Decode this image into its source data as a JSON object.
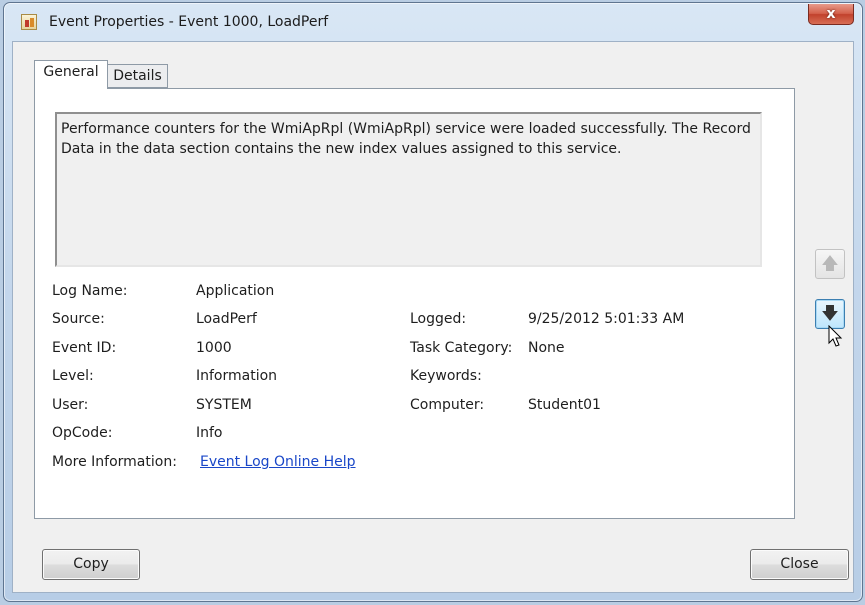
{
  "window": {
    "title": "Event Properties - Event 1000, LoadPerf",
    "close_glyph": "x"
  },
  "tabs": [
    {
      "label": "General",
      "selected": true
    },
    {
      "label": "Details",
      "selected": false
    }
  ],
  "description": "Performance counters for the WmiApRpl (WmiApRpl) service were loaded successfully. The Record Data in the data section contains the new index values assigned to this service.",
  "fields": {
    "log_name": {
      "label": "Log Name:",
      "value": "Application"
    },
    "source": {
      "label": "Source:",
      "value": "LoadPerf"
    },
    "event_id": {
      "label": "Event ID:",
      "value": "1000"
    },
    "level": {
      "label": "Level:",
      "value": "Information"
    },
    "user": {
      "label": "User:",
      "value": "SYSTEM"
    },
    "opcode": {
      "label": "OpCode:",
      "value": "Info"
    },
    "more_info": {
      "label": "More Information:",
      "link": "Event Log Online Help"
    },
    "logged": {
      "label": "Logged:",
      "value": "9/25/2012 5:01:33 AM"
    },
    "task_category": {
      "label": "Task Category:",
      "value": "None"
    },
    "keywords": {
      "label": "Keywords:",
      "value": ""
    },
    "computer": {
      "label": "Computer:",
      "value": "Student01"
    }
  },
  "nav": {
    "up_icon": "arrow-up-icon",
    "down_icon": "arrow-down-icon",
    "up_enabled": false,
    "down_enabled": true
  },
  "buttons": {
    "copy": "Copy",
    "close": "Close"
  },
  "colors": {
    "link": "#1a47c8",
    "title_close": "#c1412c",
    "nav_hover_border": "#3c7fb1"
  }
}
